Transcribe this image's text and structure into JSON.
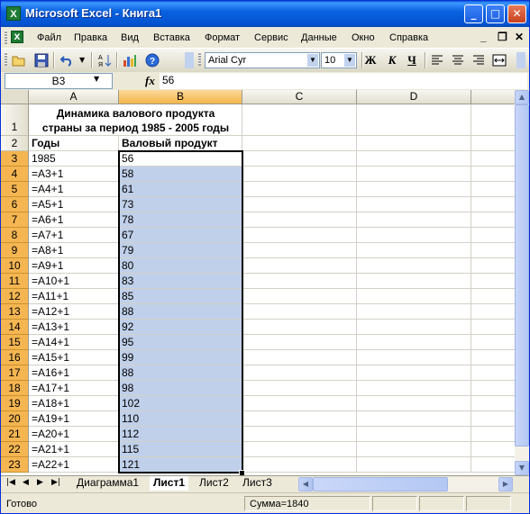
{
  "window": {
    "title": "Microsoft Excel - Книга1"
  },
  "menu": {
    "items": [
      "Файл",
      "Правка",
      "Вид",
      "Вставка",
      "Формат",
      "Сервис",
      "Данные",
      "Окно",
      "Справка"
    ]
  },
  "toolbar": {
    "font_name": "Arial Cyr",
    "font_size": "10",
    "bold_label": "Ж",
    "italic_label": "К",
    "underline_label": "Ч"
  },
  "formula_bar": {
    "name_box": "B3",
    "fx_label": "fx",
    "formula": "56"
  },
  "columns": [
    "A",
    "B",
    "C",
    "D"
  ],
  "sheet": {
    "title_line1": "Динамика валового продукта",
    "title_line2": "страны за период 1985 - 2005 годы",
    "header_a": "Годы",
    "header_b": "Валовый продукт",
    "row_numbers": [
      "1",
      "2",
      "3",
      "4",
      "5",
      "6",
      "7",
      "8",
      "9",
      "10",
      "11",
      "12",
      "13",
      "14",
      "15",
      "16",
      "17",
      "18",
      "19",
      "20",
      "21",
      "22",
      "23"
    ],
    "years": [
      "1985",
      "=A3+1",
      "=A4+1",
      "=A5+1",
      "=A6+1",
      "=A7+1",
      "=A8+1",
      "=A9+1",
      "=A10+1",
      "=A11+1",
      "=A12+1",
      "=A13+1",
      "=A14+1",
      "=A15+1",
      "=A16+1",
      "=A17+1",
      "=A18+1",
      "=A19+1",
      "=A20+1",
      "=A21+1",
      "=A22+1"
    ],
    "products": [
      "56",
      "58",
      "61",
      "73",
      "78",
      "67",
      "79",
      "80",
      "83",
      "85",
      "88",
      "92",
      "95",
      "99",
      "88",
      "98",
      "102",
      "110",
      "112",
      "115",
      "121"
    ]
  },
  "sheet_tabs": [
    "Диаграмма1",
    "Лист1",
    "Лист2",
    "Лист3"
  ],
  "active_tab": "Лист1",
  "status": {
    "ready": "Готово",
    "sum": "Сумма=1840"
  },
  "colors": {
    "selection": "#c0d0ea",
    "header_selected": "#f5b651",
    "title_bar": "#0553d1"
  }
}
